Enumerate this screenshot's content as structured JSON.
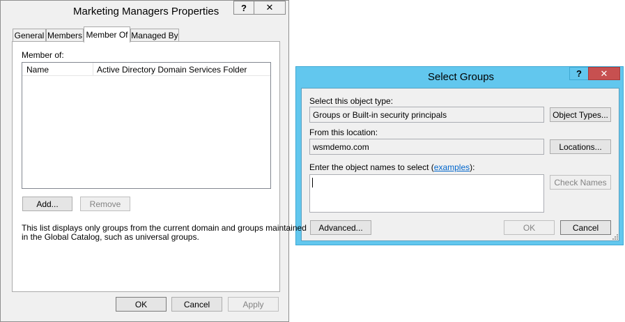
{
  "props": {
    "title": "Marketing Managers Properties",
    "help_btn": "?",
    "close_btn": "✕",
    "tabs": [
      {
        "label": "General"
      },
      {
        "label": "Members"
      },
      {
        "label": "Member Of"
      },
      {
        "label": "Managed By"
      }
    ],
    "member_of_label": "Member of:",
    "columns": [
      "Name",
      "Active Directory Domain Services Folder"
    ],
    "add_btn": "Add...",
    "remove_btn": "Remove",
    "note_line1": "This list displays only groups from the current domain and groups maintained",
    "note_line2": "in the Global Catalog, such as universal groups.",
    "ok_btn": "OK",
    "cancel_btn": "Cancel",
    "apply_btn": "Apply"
  },
  "select": {
    "title": "Select Groups",
    "help_btn": "?",
    "close_btn": "✕",
    "object_type_label": "Select this object type:",
    "object_type_value": "Groups or Built-in security principals",
    "object_types_btn": "Object Types...",
    "location_label": "From this location:",
    "location_value": "wsmdemo.com",
    "locations_btn": "Locations...",
    "names_label_pre": "Enter the object names to select (",
    "names_label_link": "examples",
    "names_label_post": "):",
    "names_value": "",
    "check_names_btn": "Check Names",
    "advanced_btn": "Advanced...",
    "ok_btn": "OK",
    "cancel_btn": "Cancel"
  },
  "colors": {
    "props_frame": "#f0f0f0",
    "select_frame": "#62c7ee",
    "close_red": "#c75050"
  }
}
